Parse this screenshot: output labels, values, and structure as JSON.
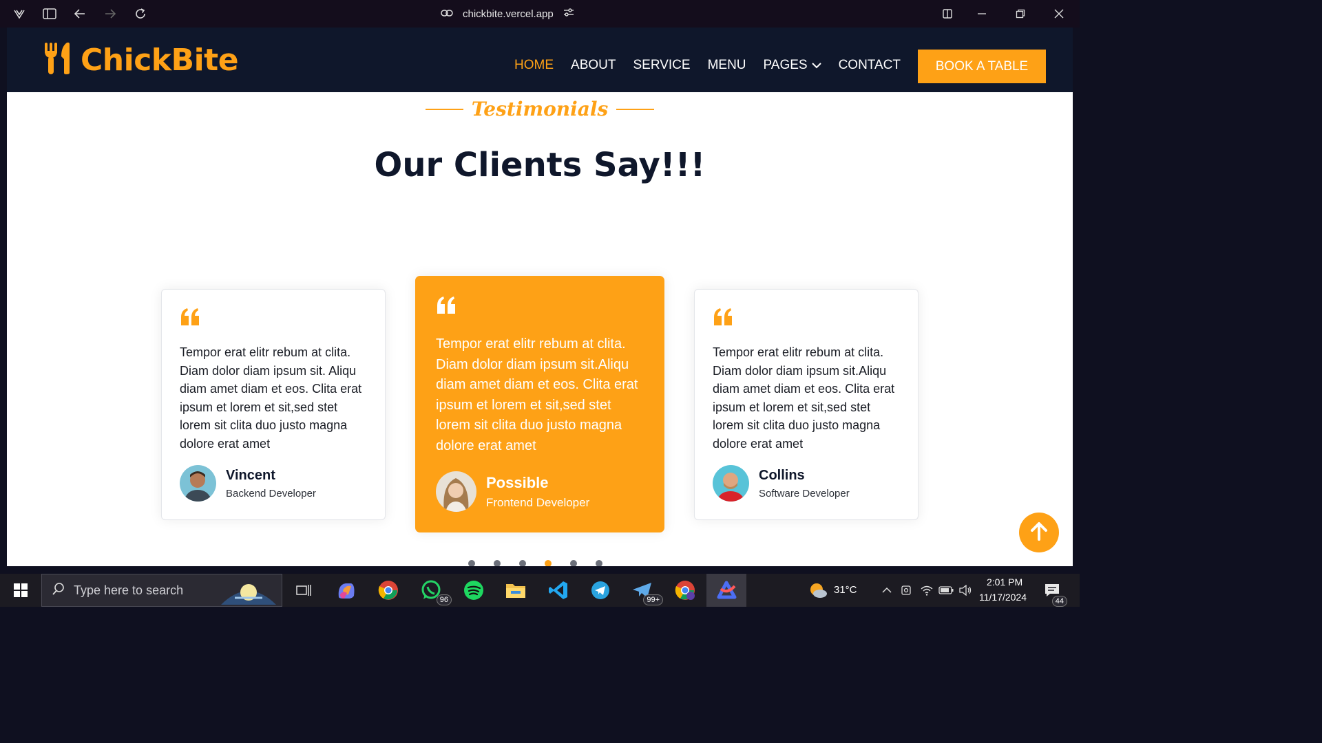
{
  "browser": {
    "url": "chickbite.vercel.app"
  },
  "navbar": {
    "brand": "ChickBite",
    "links": [
      {
        "label": "HOME"
      },
      {
        "label": "ABOUT"
      },
      {
        "label": "SERVICE"
      },
      {
        "label": "MENU"
      },
      {
        "label": "PAGES"
      },
      {
        "label": "CONTACT"
      }
    ],
    "book_button": "BOOK A TABLE",
    "active_link": "HOME"
  },
  "section": {
    "tag": "Testimonials",
    "title": "Our Clients Say!!!"
  },
  "testimonials": [
    {
      "text": "Tempor erat elitr rebum at clita. Diam dolor diam ipsum sit. Aliqu diam amet diam et eos. Clita erat ipsum et lorem et sit,sed stet lorem sit clita duo justo magna dolore erat amet",
      "name": "Vincent",
      "role": "Backend Developer"
    },
    {
      "text": "Tempor erat elitr rebum at clita. Diam dolor diam ipsum sit.Aliqu diam amet diam et eos. Clita erat ipsum et lorem et sit,sed stet lorem sit clita duo justo magna dolore erat amet",
      "name": "Possible",
      "role": "Frontend Developer"
    },
    {
      "text": "Tempor erat elitr rebum at clita. Diam dolor diam ipsum sit.Aliqu diam amet diam et eos. Clita erat ipsum et lorem et sit,sed stet lorem sit clita duo justo magna dolore erat amet",
      "name": "Collins",
      "role": "Software Developer"
    }
  ],
  "carousel": {
    "dot_count": 6,
    "active_dot": 4
  },
  "taskbar": {
    "search_placeholder": "Type here to search",
    "whatsapp_badge": "96",
    "telegram_badge": "99+",
    "weather": "31°C",
    "time": "2:01 PM",
    "date": "11/17/2024",
    "notification_count": "44"
  },
  "colors": {
    "accent": "#fea116",
    "navbar_bg": "#0f172b"
  }
}
